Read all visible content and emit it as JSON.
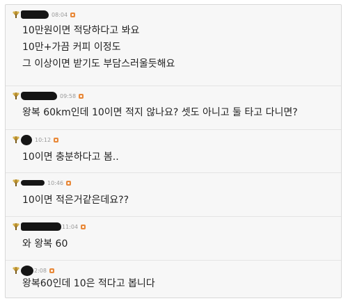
{
  "comments": [
    {
      "time": "08:04",
      "lines": [
        "10만원이면 적당하다고 봐요",
        "10만+가끔 커피 이정도",
        "그 이상이면 받기도 부담스러울듯해요"
      ]
    },
    {
      "time": "09:58",
      "lines": [
        "왕복 60km인데 10이면 적지 않나요? 셋도 아니고 둘 타고 다니면?"
      ]
    },
    {
      "time": "10:12",
      "lines": [
        "10이면 충분하다고 봄.."
      ]
    },
    {
      "time": "10:46",
      "lines": [
        "10이면 적은거같은데요??"
      ]
    },
    {
      "time": "11:04",
      "lines": [
        "와 왕복 60"
      ]
    },
    {
      "time": "2:08",
      "lines": [
        "왕복60인데 10은 적다고 봅니다"
      ]
    }
  ],
  "icons": {
    "rank": "rank-badge-icon",
    "reply": "reply-icon"
  },
  "colors": {
    "background": "#f7f7f7",
    "text": "#222222",
    "timestamp": "#9a9a9a",
    "accent": "#e8893a"
  }
}
